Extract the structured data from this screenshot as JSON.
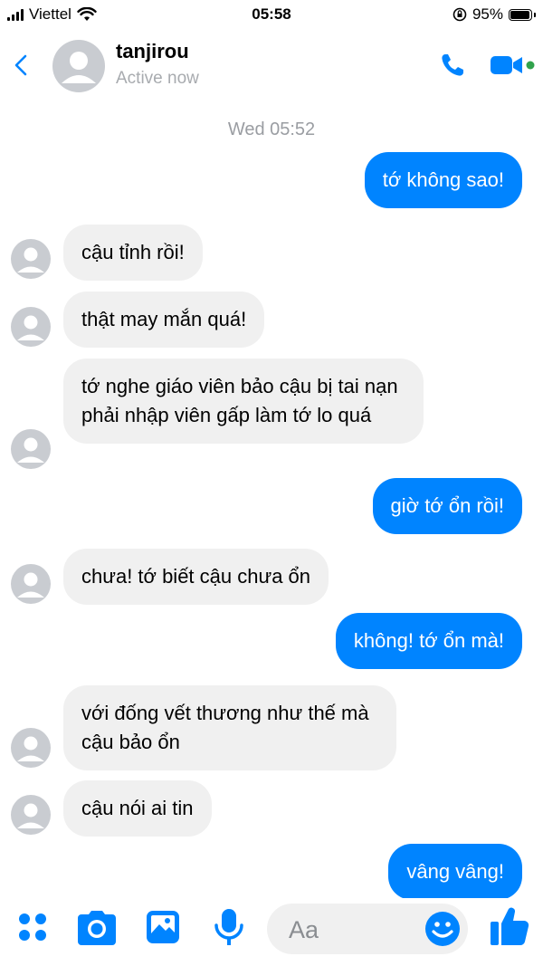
{
  "status_bar": {
    "carrier": "Viettel",
    "time": "05:58",
    "battery": "95%",
    "battery_level": 0.95
  },
  "header": {
    "name": "tanjirou",
    "presence": "Active now"
  },
  "chat": {
    "date_separator": "Wed 05:52",
    "messages": [
      {
        "from": "me",
        "text": "tớ không sao!"
      },
      {
        "from": "them",
        "text": "cậu tỉnh rồi!"
      },
      {
        "from": "them",
        "text": "thật may mắn quá!"
      },
      {
        "from": "them",
        "text": "tớ nghe giáo viên bảo cậu bị tai nạn phải nhập viên gấp làm tớ lo quá"
      },
      {
        "from": "me",
        "text": "giờ tớ ổn rồi!"
      },
      {
        "from": "them",
        "text": "chưa! tớ biết cậu chưa ổn"
      },
      {
        "from": "me",
        "text": "không! tớ ổn mà!"
      },
      {
        "from": "them",
        "text": "với đống vết thương như thế mà cậu bảo ổn"
      },
      {
        "from": "them",
        "text": "cậu nói ai tin"
      },
      {
        "from": "me",
        "text": "vâng vâng!"
      }
    ]
  },
  "composer": {
    "placeholder": "Aa"
  },
  "colors": {
    "accent": "#0084ff",
    "incoming_bubble": "#f0f0f0",
    "presence_dot": "#31a24c"
  },
  "icons": [
    "back-chevron-icon",
    "phone-icon",
    "video-camera-icon",
    "apps-grid-icon",
    "camera-icon",
    "gallery-icon",
    "microphone-icon",
    "emoji-icon",
    "thumbs-up-icon"
  ]
}
